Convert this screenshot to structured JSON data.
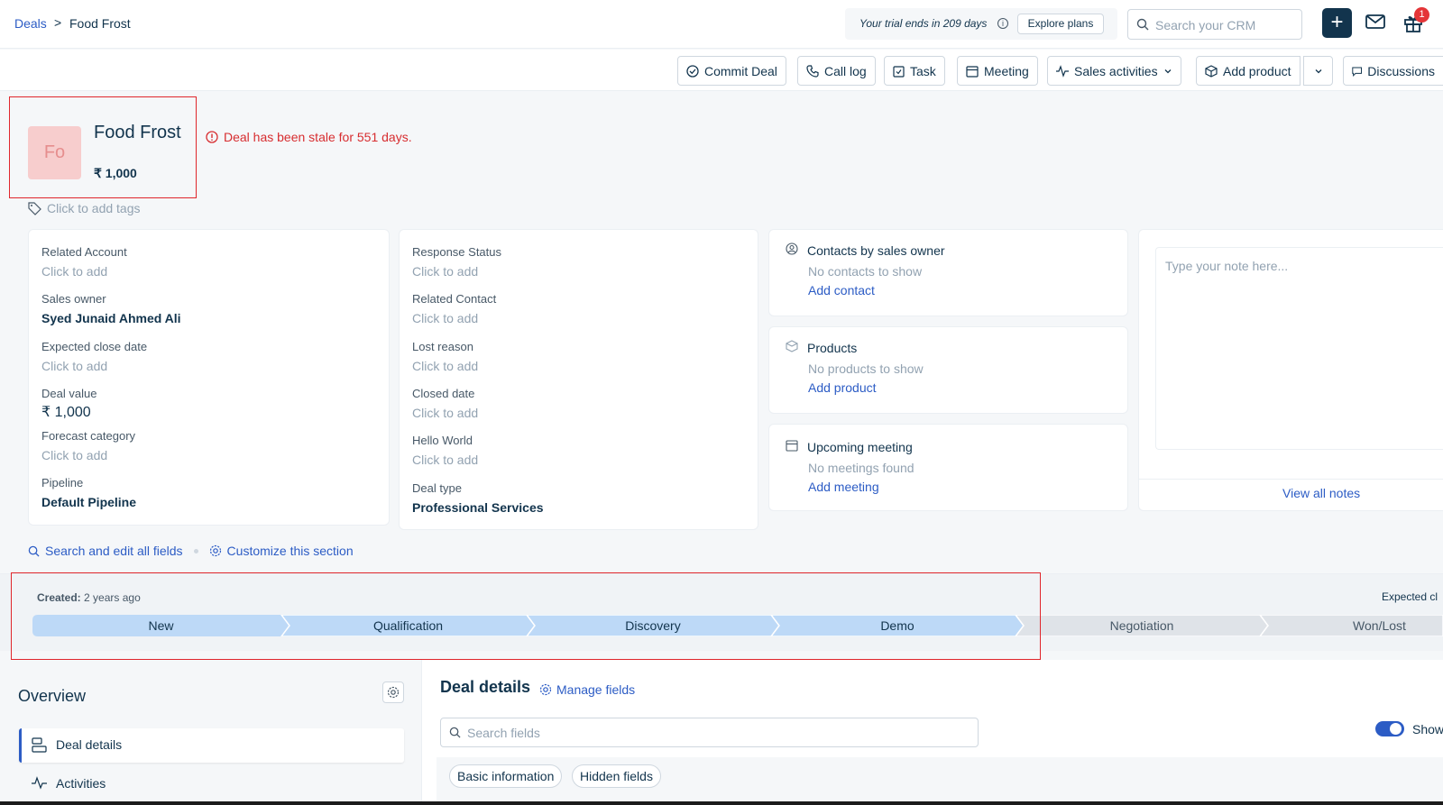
{
  "breadcrumb": {
    "parent": "Deals",
    "separator": ">",
    "current": "Food Frost"
  },
  "topbar": {
    "trial_text": "Your trial ends in 209 days",
    "info_symbol": "i",
    "explore_label": "Explore plans",
    "search_placeholder": "Search your CRM",
    "plus_symbol": "+",
    "gift_badge_count": "1"
  },
  "actions": {
    "commit_deal": "Commit Deal",
    "call_log": "Call log",
    "task": "Task",
    "meeting": "Meeting",
    "sales_activities": "Sales activities",
    "add_product": "Add product",
    "discussions": "Discussions"
  },
  "deal": {
    "avatar_initials": "Fo",
    "name": "Food Frost",
    "amount": "₹ 1,000",
    "stale_message": "Deal has been stale for 551 days.",
    "tags_placeholder": "Click to add tags"
  },
  "fields_col1": [
    {
      "label": "Related Account",
      "value": "Click to add",
      "empty": true
    },
    {
      "label": "Sales owner",
      "value": "Syed Junaid Ahmed Ali",
      "empty": false
    },
    {
      "label": "Expected close date",
      "value": "Click to add",
      "empty": true
    },
    {
      "label": "Deal value",
      "value": "₹ 1,000",
      "empty": false
    },
    {
      "label": "Forecast category",
      "value": "Click to add",
      "empty": true
    },
    {
      "label": "Pipeline",
      "value": "Default Pipeline",
      "empty": false
    }
  ],
  "fields_col2": [
    {
      "label": "Response Status",
      "value": "Click to add",
      "empty": true
    },
    {
      "label": "Related Contact",
      "value": "Click to add",
      "empty": true
    },
    {
      "label": "Lost reason",
      "value": "Click to add",
      "empty": true
    },
    {
      "label": "Closed date",
      "value": "Click to add",
      "empty": true
    },
    {
      "label": "Hello World",
      "value": "Click to add",
      "empty": true
    },
    {
      "label": "Deal type",
      "value": "Professional Services",
      "empty": false
    }
  ],
  "widgets": {
    "contacts": {
      "title": "Contacts by sales owner",
      "empty": "No contacts to show",
      "link": "Add contact"
    },
    "products": {
      "title": "Products",
      "empty": "No products to show",
      "link": "Add product"
    },
    "meetings": {
      "title": "Upcoming meeting",
      "empty": "No meetings found",
      "link": "Add meeting"
    }
  },
  "notes": {
    "placeholder": "Type your note here...",
    "view_all": "View all notes"
  },
  "section_links": {
    "search_edit": "Search and edit all fields",
    "customize": "Customize this section"
  },
  "pipeline": {
    "created_label": "Created:",
    "created_value": "2 years ago",
    "expected_label": "Expected cl",
    "stages": [
      {
        "name": "New",
        "active": true
      },
      {
        "name": "Qualification",
        "active": true
      },
      {
        "name": "Discovery",
        "active": true
      },
      {
        "name": "Demo",
        "active": true
      },
      {
        "name": "Negotiation",
        "active": false
      },
      {
        "name": "Won/Lost",
        "active": false
      }
    ]
  },
  "overview": {
    "title": "Overview",
    "nav": [
      {
        "label": "Deal details",
        "selected": true
      },
      {
        "label": "Activities",
        "selected": false
      }
    ]
  },
  "deal_details": {
    "title": "Deal details",
    "manage_fields": "Manage fields",
    "search_placeholder": "Search fields",
    "show_label": "Show",
    "chips": [
      "Basic information",
      "Hidden fields"
    ]
  },
  "colors": {
    "accent": "#2c5cc5",
    "dark": "#12344d",
    "stale_red": "#d72d30",
    "stage_active": "#bdd9f7",
    "stage_inactive": "#dfe3e8"
  }
}
